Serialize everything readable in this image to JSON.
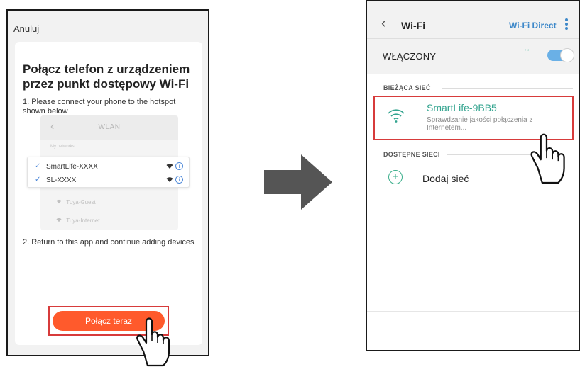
{
  "left_phone": {
    "cancel_label": "Anuluj",
    "title": "Połącz telefon z urządzeniem przez punkt dostępowy Wi-Fi",
    "step1": "1. Please connect your phone to the hotspot shown below",
    "step2": "2. Return to this app and continue adding devices",
    "mini_screen": {
      "title": "WLAN",
      "subheader": "My networks",
      "selected_networks": [
        {
          "name": "SmartLife-XXXX",
          "icon": "wifi-icon",
          "info_glyph": "i"
        },
        {
          "name": "SL-XXXX",
          "icon": "wifi-icon",
          "info_glyph": "i"
        }
      ],
      "other_networks": [
        {
          "name": "Tuya-Guest"
        },
        {
          "name": "Tuya-Internet"
        }
      ]
    },
    "connect_button": "Połącz teraz"
  },
  "right_phone": {
    "header_title": "Wi-Fi",
    "wifi_direct_label": "Wi-Fi Direct",
    "enabled_label": "WŁĄCZONY",
    "toggle_on": true,
    "current_section_label": "BIEŻĄCA SIEĆ",
    "current_network": {
      "name": "SmartLife-9BB5",
      "status": "Sprawdzanie jakości połączenia z Internetem..."
    },
    "available_section_label": "DOSTĘPNE SIECI",
    "add_network_label": "Dodaj sieć"
  },
  "colors": {
    "accent_orange": "#ff5a2c",
    "highlight_red": "#d73b3b",
    "teal": "#33a48f",
    "blue": "#3d88c9",
    "arrow_gray": "#555555"
  }
}
